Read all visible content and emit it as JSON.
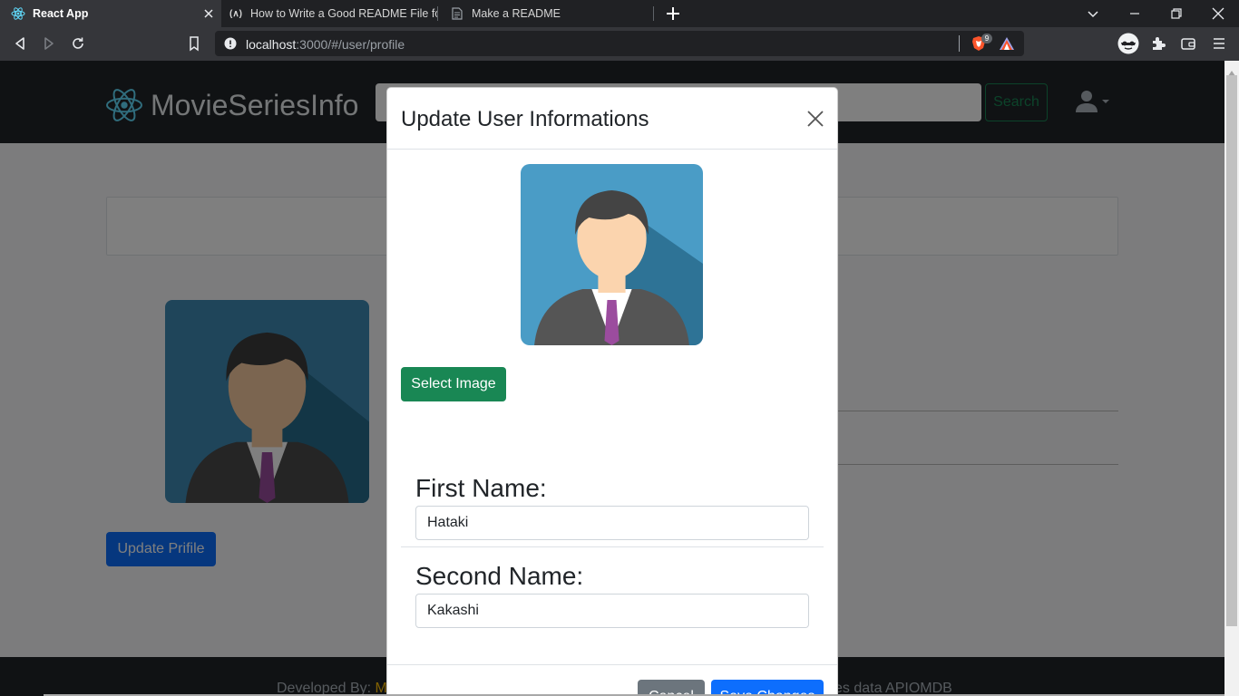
{
  "browser": {
    "tabs": [
      {
        "title": "React App",
        "active": true,
        "icon": "react-icon"
      },
      {
        "title": "How to Write a Good README File for",
        "active": false,
        "icon": "freecodecamp-icon"
      },
      {
        "title": "Make a README",
        "active": false,
        "icon": "document-icon"
      }
    ],
    "url_host": "localhost",
    "url_path": ":3000/#/user/profile",
    "shield_count": "9"
  },
  "navbar": {
    "brand": "MovieSeriesInfo",
    "search_placeholder": "",
    "search_button": "Search"
  },
  "profile": {
    "update_button": "Update Prifile"
  },
  "footer": {
    "prefix": "Developed By: ",
    "highlight": "M",
    "suffix": "es data APIOMDB"
  },
  "modal": {
    "title": "Update User Informations",
    "select_image_button": "Select Image",
    "first_name_label": "First Name:",
    "first_name_value": "Hataki",
    "second_name_label": "Second Name:",
    "second_name_value": "Kakashi",
    "cancel_button": "Cancel",
    "save_button": "Save Changes"
  },
  "colors": {
    "navbar": "#212529",
    "primary": "#0d6efd",
    "success": "#198754",
    "secondary": "#6c757d",
    "react": "#61dafb"
  }
}
